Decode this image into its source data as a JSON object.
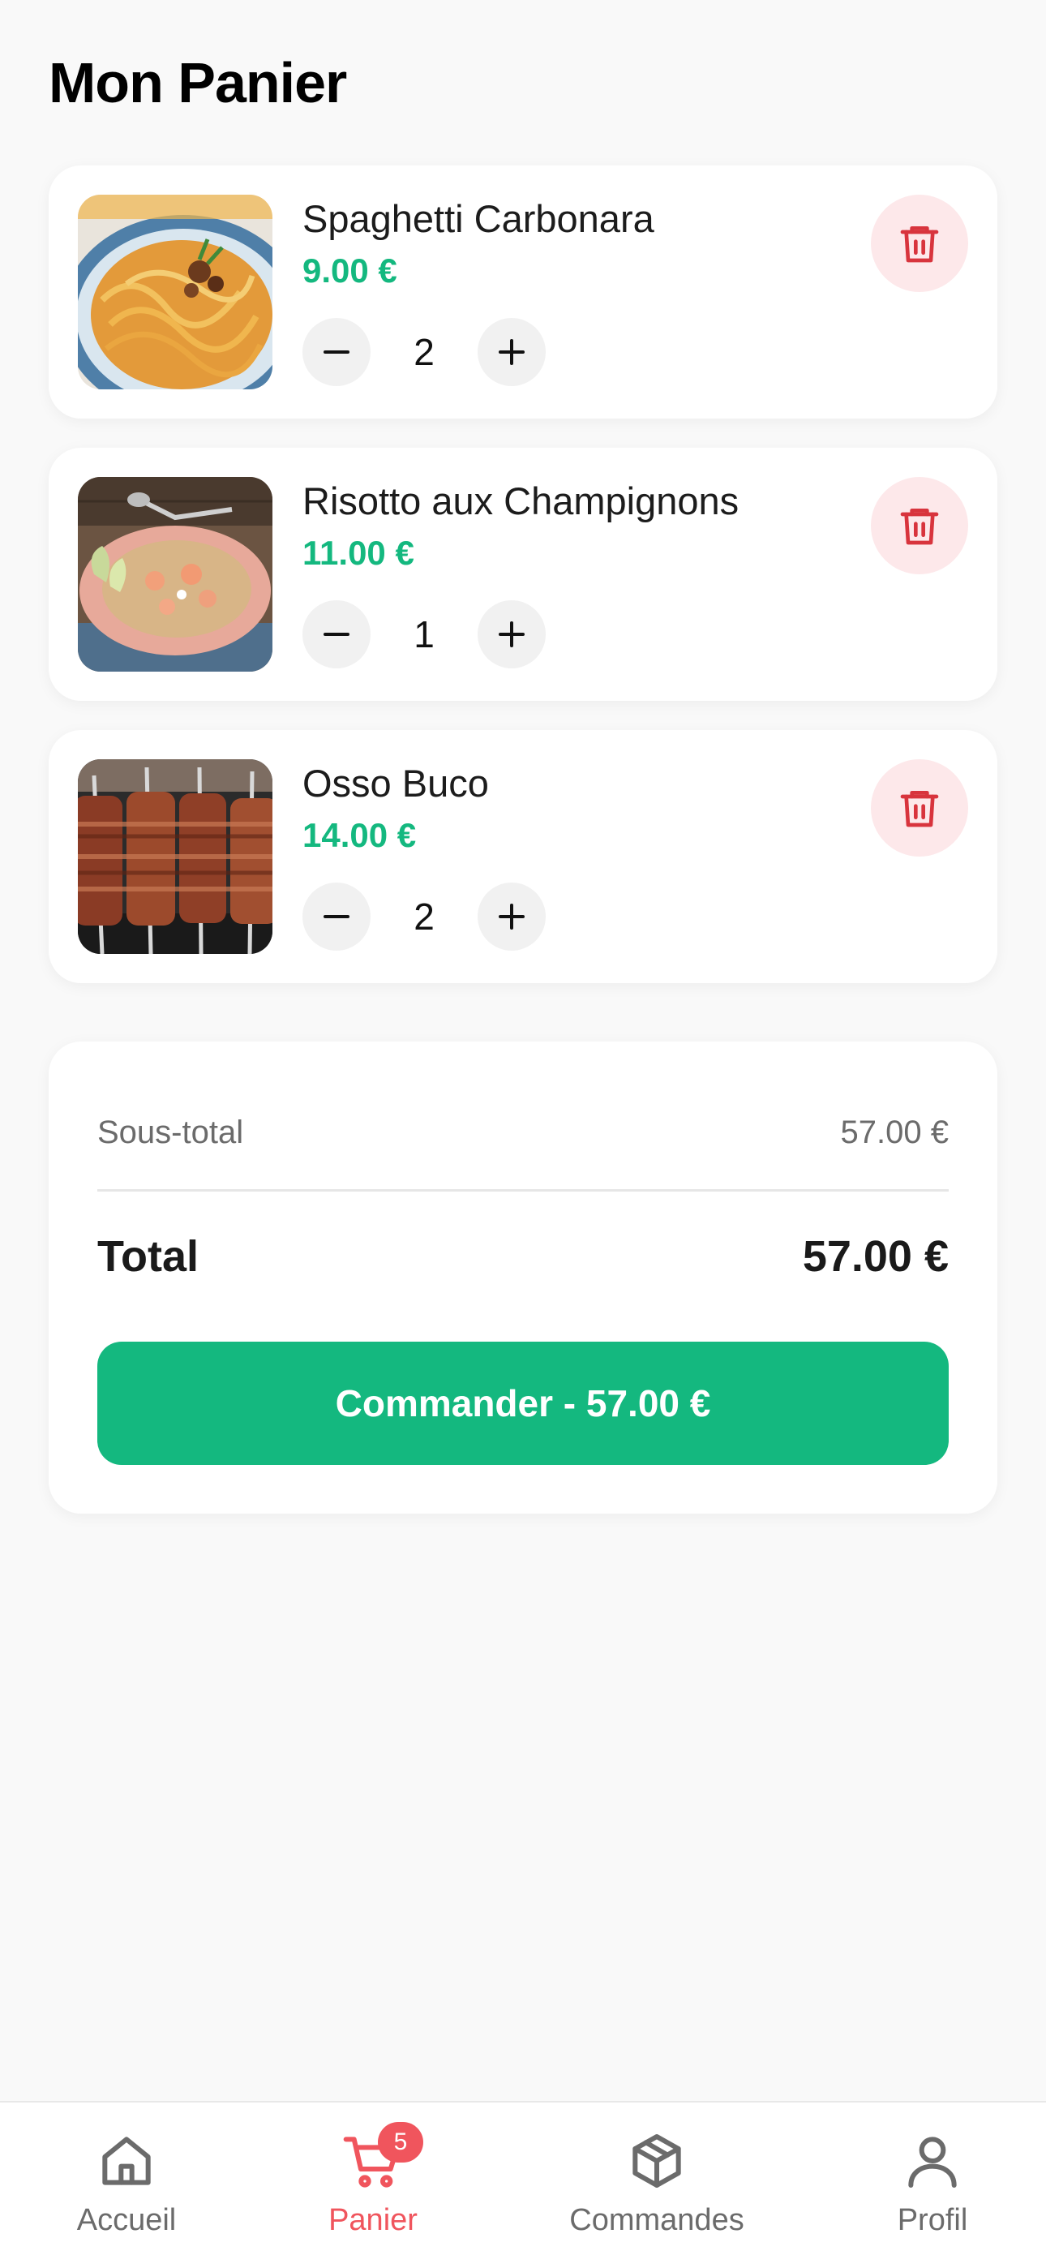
{
  "page": {
    "title": "Mon Panier"
  },
  "cart": {
    "items": [
      {
        "name": "Spaghetti Carbonara",
        "price": "9.00 €",
        "quantity": "2",
        "image": "spaghetti-photo"
      },
      {
        "name": "Risotto aux Champignons",
        "price": "11.00 €",
        "quantity": "1",
        "image": "risotto-photo"
      },
      {
        "name": "Osso Buco",
        "price": "14.00 €",
        "quantity": "2",
        "image": "osso-buco-photo"
      }
    ]
  },
  "summary": {
    "subtotal_label": "Sous-total",
    "subtotal_value": "57.00 €",
    "total_label": "Total",
    "total_value": "57.00 €",
    "order_button": "Commander - 57.00 €"
  },
  "nav": {
    "items": [
      {
        "label": "Accueil",
        "icon": "home-icon"
      },
      {
        "label": "Panier",
        "icon": "cart-icon",
        "badge": "5",
        "active": true
      },
      {
        "label": "Commandes",
        "icon": "package-icon"
      },
      {
        "label": "Profil",
        "icon": "user-icon"
      }
    ]
  },
  "colors": {
    "accent_green": "#14b87f",
    "danger_red": "#d8343d",
    "active_nav": "#f0555d",
    "background": "#f9f9f9"
  }
}
